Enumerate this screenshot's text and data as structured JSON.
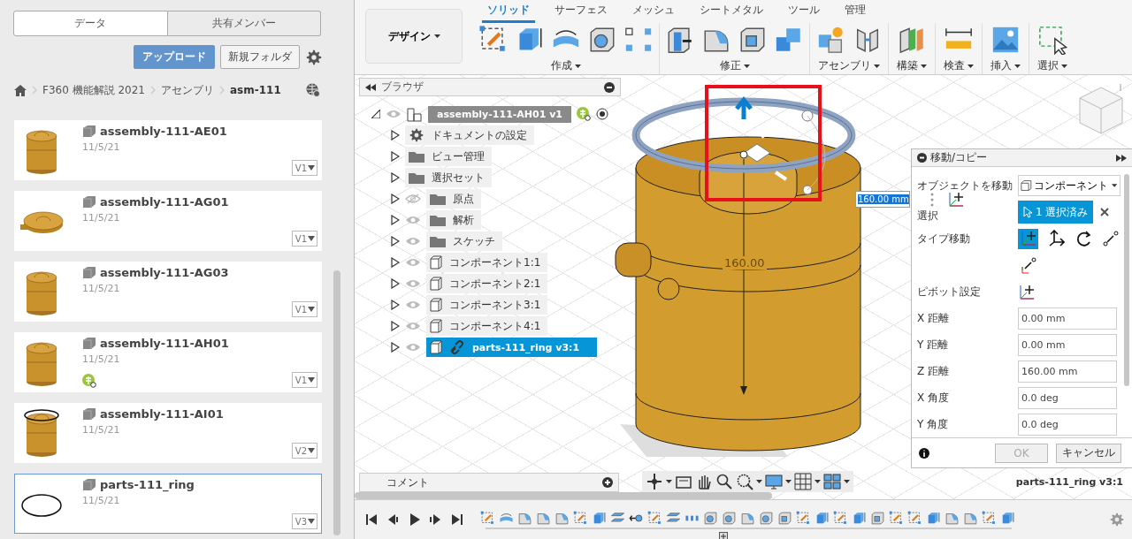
{
  "left_panel": {
    "tabs": [
      {
        "label": "データ",
        "selected": true
      },
      {
        "label": "共有メンバー",
        "selected": false
      }
    ],
    "upload_button": "アップロード",
    "new_folder_button": "新規フォルダ",
    "breadcrumb": [
      {
        "label": "F360 機能解説 2021",
        "current": false
      },
      {
        "label": "アセンブリ",
        "current": false
      },
      {
        "label": "asm-111",
        "current": true
      }
    ],
    "files": [
      {
        "name": "assembly-111-AE01",
        "date": "11/5/21",
        "version": "V1",
        "kind": "cup",
        "shared": false,
        "selected": false
      },
      {
        "name": "assembly-111-AG01",
        "date": "11/5/21",
        "version": "V1",
        "kind": "lid",
        "shared": false,
        "selected": false
      },
      {
        "name": "assembly-111-AG03",
        "date": "11/5/21",
        "version": "V1",
        "kind": "cup",
        "shared": false,
        "selected": false
      },
      {
        "name": "assembly-111-AH01",
        "date": "11/5/21",
        "version": "V1",
        "kind": "cup",
        "shared": true,
        "selected": false
      },
      {
        "name": "assembly-111-AI01",
        "date": "11/5/21",
        "version": "V2",
        "kind": "cup-ring",
        "shared": false,
        "selected": false
      },
      {
        "name": "parts-111_ring",
        "date": "11/5/21",
        "version": "V3",
        "kind": "ring",
        "shared": false,
        "selected": true
      }
    ]
  },
  "toolbar": {
    "workspace": "デザイン",
    "tabs": [
      {
        "label": "ソリッド",
        "selected": true
      },
      {
        "label": "サーフェス",
        "selected": false
      },
      {
        "label": "メッシュ",
        "selected": false
      },
      {
        "label": "シートメタル",
        "selected": false
      },
      {
        "label": "ツール",
        "selected": false
      },
      {
        "label": "管理",
        "selected": false
      }
    ],
    "groups": [
      "作成",
      "修正",
      "アセンブリ",
      "構築",
      "検査",
      "挿入",
      "選択"
    ]
  },
  "browser": {
    "title": "ブラウザ",
    "root": {
      "label": "assembly-111-AH01 v1",
      "expanded": true,
      "shared": true,
      "children": [
        {
          "label": "ドキュメントの設定",
          "kind": "settings",
          "expanded": false,
          "selected": false
        },
        {
          "label": "ビュー管理",
          "kind": "folder",
          "expanded": false,
          "selected": false
        },
        {
          "label": "選択セット",
          "kind": "folder",
          "expanded": false,
          "selected": false
        },
        {
          "label": "原点",
          "kind": "folder",
          "visible": false,
          "expanded": false,
          "selected": false
        },
        {
          "label": "解析",
          "kind": "folder",
          "visible": true,
          "expanded": false,
          "selected": false
        },
        {
          "label": "スケッチ",
          "kind": "folder",
          "visible": true,
          "expanded": false,
          "selected": false
        },
        {
          "label": "コンポーネント1:1",
          "kind": "component",
          "visible": true,
          "expanded": false,
          "selected": false
        },
        {
          "label": "コンポーネント2:1",
          "kind": "component",
          "visible": true,
          "expanded": false,
          "selected": false
        },
        {
          "label": "コンポーネント3:1",
          "kind": "component",
          "visible": true,
          "expanded": false,
          "selected": false
        },
        {
          "label": "コンポーネント4:1",
          "kind": "component",
          "visible": true,
          "expanded": false,
          "selected": false
        },
        {
          "label": "parts-111_ring v3:1",
          "kind": "linked-component",
          "visible": true,
          "expanded": false,
          "selected": true
        }
      ]
    }
  },
  "comments": {
    "title": "コメント"
  },
  "viewport": {
    "dimension_label": "160.00",
    "distance_input": "160.00 mm",
    "selection_label": "parts-111_ring v3:1"
  },
  "move_copy": {
    "title": "移動/コピー",
    "object_label": "オブジェクトを移動",
    "object_value": "コンポーネント",
    "selection_label": "選択",
    "selection_button": "1 選択済み",
    "type_label": "タイプ移動",
    "types": [
      {
        "kind": "free",
        "selected": true
      },
      {
        "kind": "translate",
        "selected": false
      },
      {
        "kind": "rotate",
        "selected": false
      },
      {
        "kind": "point-to-point",
        "selected": false
      },
      {
        "kind": "point-to-position",
        "selected": false
      }
    ],
    "pivot_label": "ピボット設定",
    "fields": [
      {
        "label": "X 距離",
        "value": "0.00 mm"
      },
      {
        "label": "Y 距離",
        "value": "0.00 mm"
      },
      {
        "label": "Z 距離",
        "value": "160.00 mm"
      },
      {
        "label": "X 角度",
        "value": "0.0 deg"
      },
      {
        "label": "Y 角度",
        "value": "0.0 deg"
      }
    ],
    "buttons": [
      {
        "label": "OK",
        "disabled": true
      },
      {
        "label": "キャンセル",
        "disabled": false
      }
    ]
  }
}
